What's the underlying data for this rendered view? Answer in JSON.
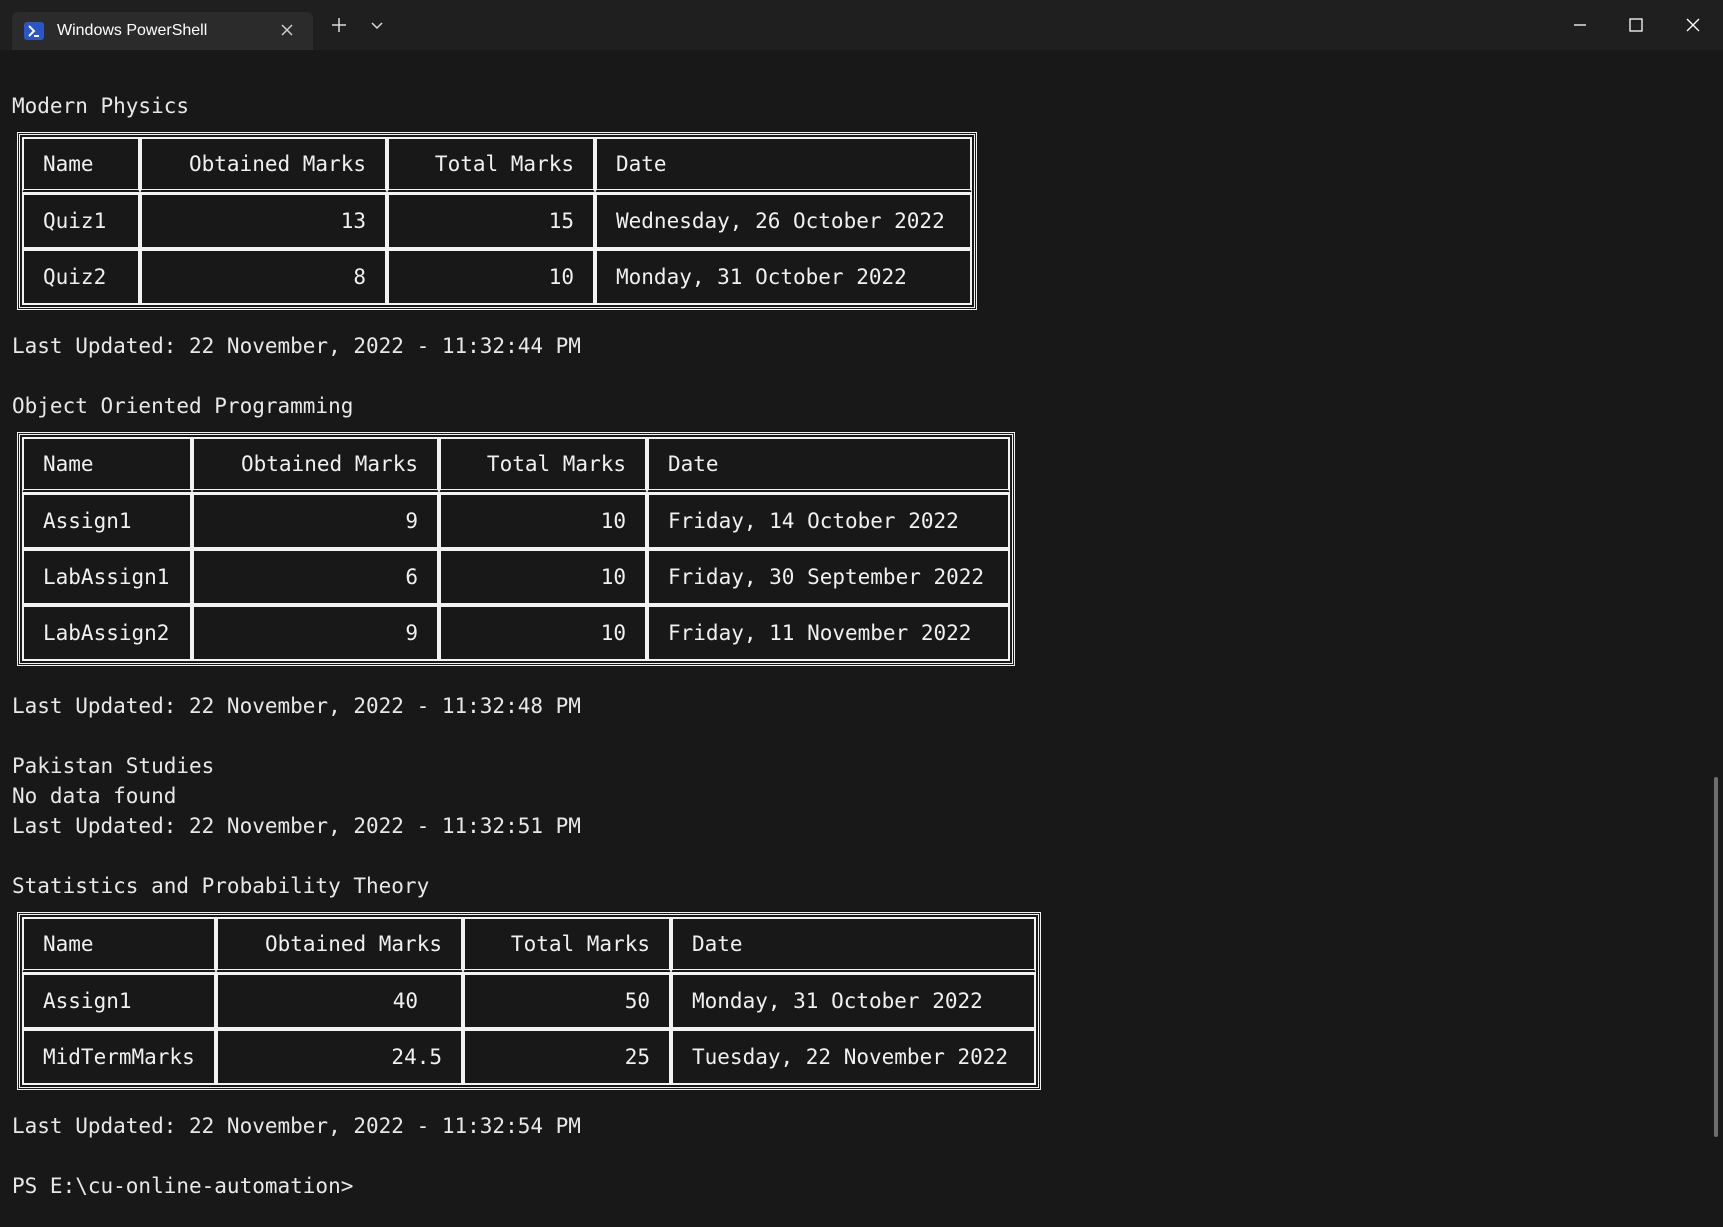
{
  "window": {
    "tab_title": "Windows PowerShell",
    "tab_icon": "powershell-icon",
    "new_tab_icon": "plus-icon",
    "dropdown_icon": "chevron-down-icon",
    "minimize_icon": "minimize-icon",
    "maximize_icon": "maximize-icon",
    "close_icon": "close-icon"
  },
  "sections": [
    {
      "title": "Modern Physics",
      "headers": [
        "Name",
        "Obtained Marks",
        "Total Marks",
        "Date"
      ],
      "rows": [
        [
          "Quiz1",
          "13",
          "15",
          "Wednesday, 26 October 2022"
        ],
        [
          "Quiz2",
          "8",
          "10",
          "Monday, 31 October 2022"
        ]
      ],
      "updated": "Last Updated: 22 November, 2022 - 11:32:44 PM"
    },
    {
      "title": "Object Oriented Programming",
      "headers": [
        "Name",
        "Obtained Marks",
        "Total Marks",
        "Date"
      ],
      "rows": [
        [
          "Assign1",
          "9",
          "10",
          "Friday, 14 October 2022"
        ],
        [
          "LabAssign1",
          "6",
          "10",
          "Friday, 30 September 2022"
        ],
        [
          "LabAssign2",
          "9",
          "10",
          "Friday, 11 November 2022"
        ]
      ],
      "updated": "Last Updated: 22 November, 2022 - 11:32:48 PM"
    },
    {
      "title": "Pakistan Studies",
      "message": "No data found",
      "updated": "Last Updated: 22 November, 2022 - 11:32:51 PM"
    },
    {
      "title": "Statistics and Probability Theory",
      "headers": [
        "Name",
        "Obtained Marks",
        "Total Marks",
        "Date"
      ],
      "rows": [
        [
          "Assign1",
          "40",
          "50",
          "Monday, 31 October 2022"
        ],
        [
          "MidTermMarks",
          "24.5",
          "25",
          "Tuesday, 22 November 2022"
        ]
      ],
      "updated": "Last Updated: 22 November, 2022 - 11:32:54 PM"
    }
  ],
  "prompt": "PS E:\\cu-online-automation>",
  "colors": {
    "titlebar": "#1f1f1f",
    "tab": "#2b2b2b",
    "terminal_bg": "#181818",
    "text": "#e8e8e8",
    "tab_icon": "#2a56c6"
  }
}
